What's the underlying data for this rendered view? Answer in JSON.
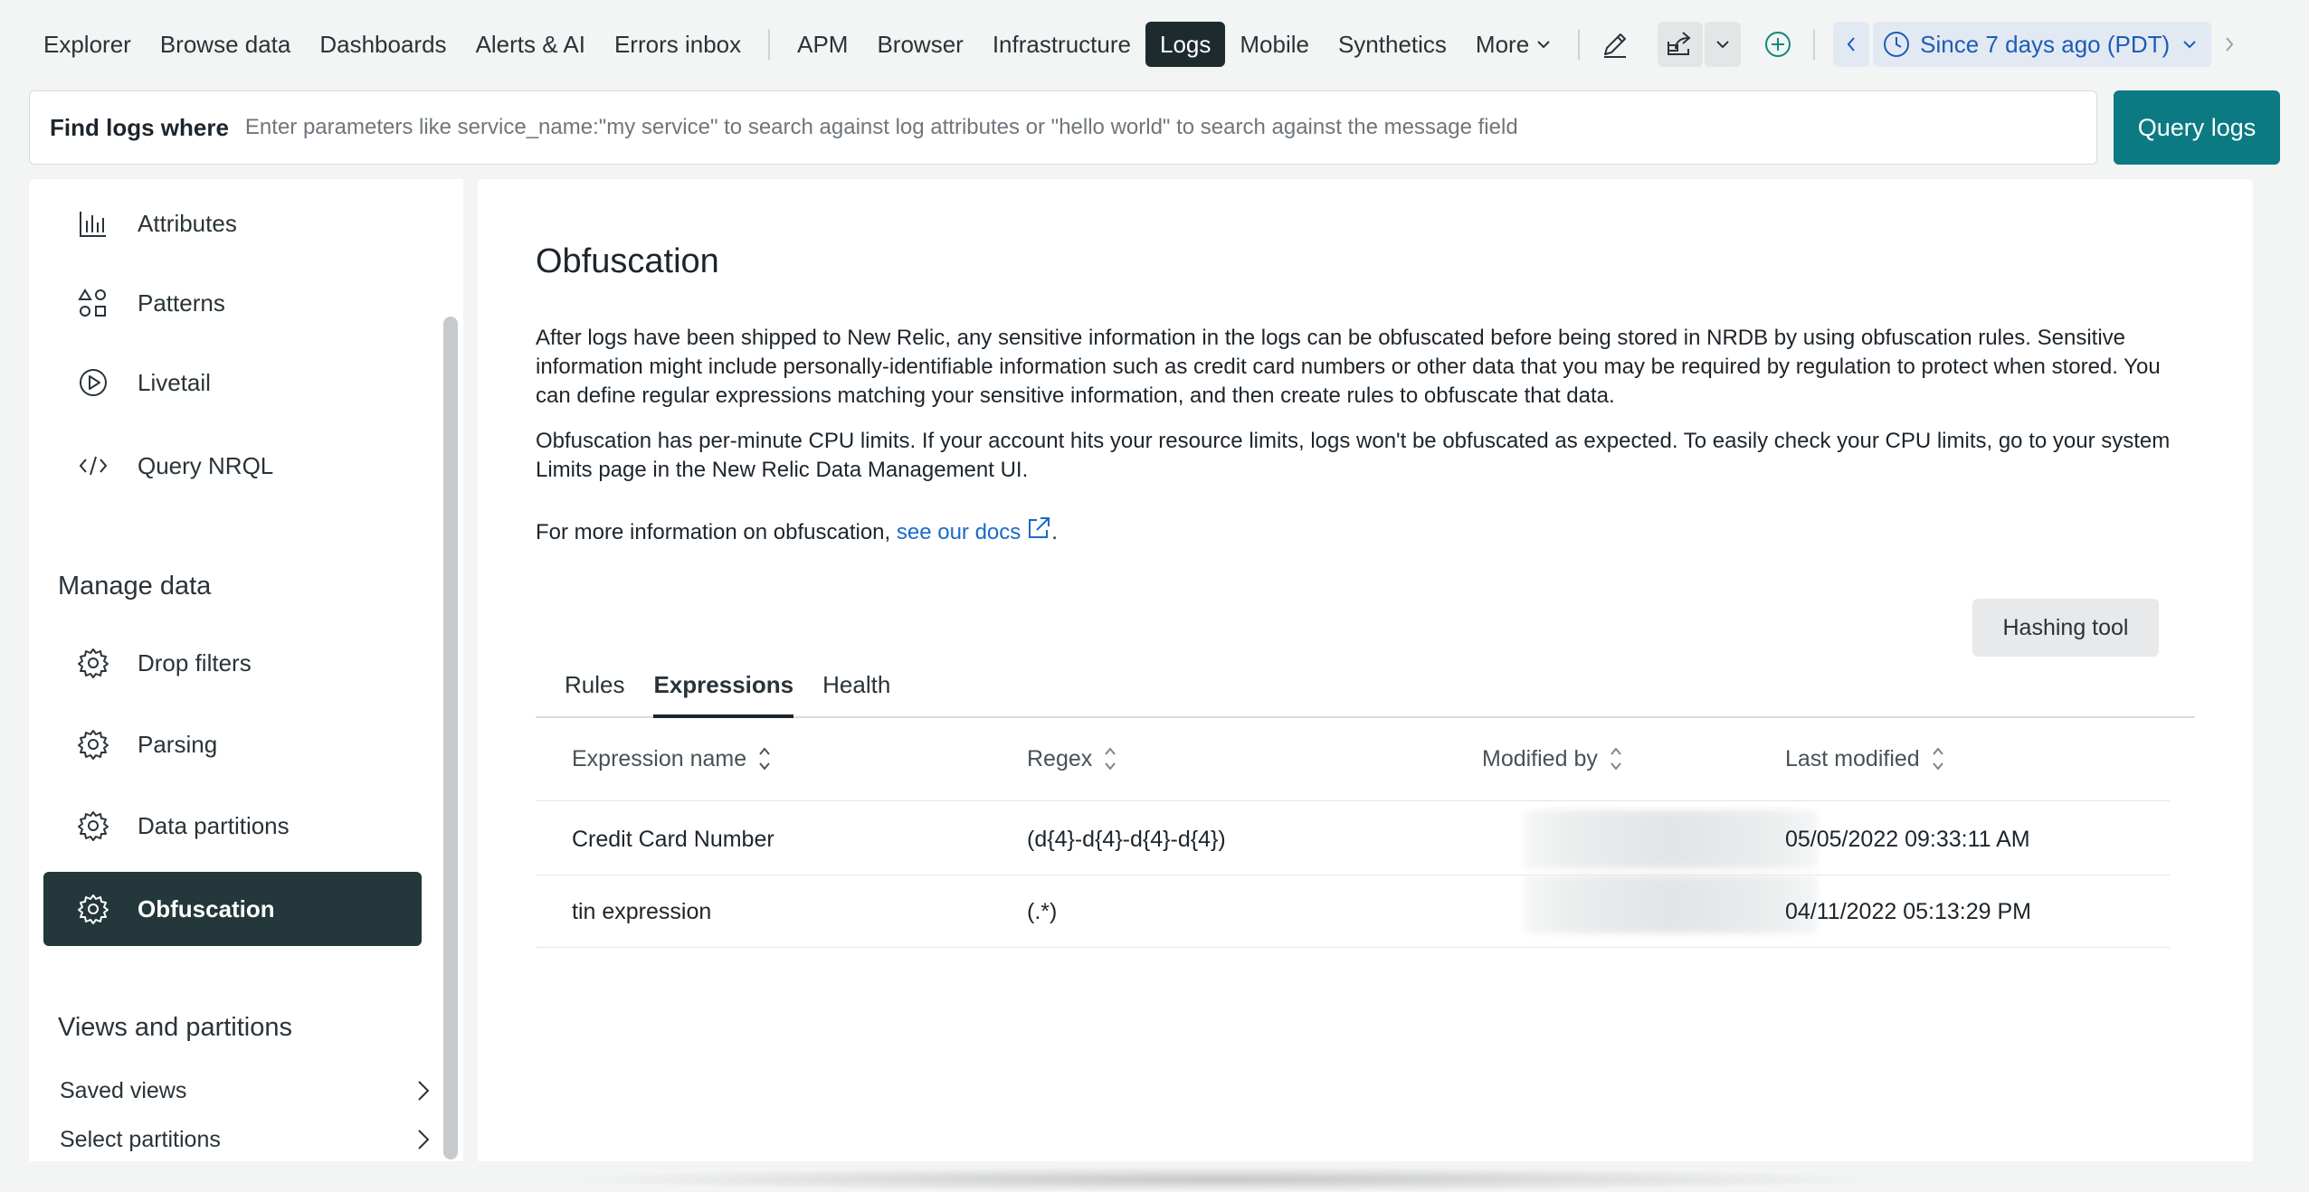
{
  "nav": {
    "items": [
      {
        "label": "Explorer"
      },
      {
        "label": "Browse data"
      },
      {
        "label": "Dashboards"
      },
      {
        "label": "Alerts & AI"
      },
      {
        "label": "Errors inbox"
      }
    ],
    "items2": [
      {
        "label": "APM"
      },
      {
        "label": "Browser"
      },
      {
        "label": "Infrastructure"
      },
      {
        "label": "Logs",
        "active": true
      },
      {
        "label": "Mobile"
      },
      {
        "label": "Synthetics"
      },
      {
        "label": "More"
      }
    ],
    "time_label": "Since 7 days ago (PDT)",
    "icons": [
      "pencil-icon",
      "share-icon",
      "chevron-down-icon",
      "plus-circle-icon",
      "chevron-left-icon",
      "clock-icon",
      "chevron-right-icon"
    ],
    "accent": "#1c5db6"
  },
  "search": {
    "label": "Find logs where",
    "placeholder": "Enter parameters like service_name:\"my service\" to search against log attributes or \"hello world\" to search against the message field",
    "button": "Query logs",
    "button_color": "#0b7a82"
  },
  "sidebar": {
    "items": [
      {
        "label": "Attributes",
        "icon": "bar-chart-icon"
      },
      {
        "label": "Patterns",
        "icon": "patterns-icon"
      },
      {
        "label": "Livetail",
        "icon": "play-circle-icon"
      },
      {
        "label": "Query NRQL",
        "icon": "code-icon"
      }
    ],
    "manage_heading": "Manage data",
    "manage_items": [
      {
        "label": "Drop filters",
        "icon": "gear-icon"
      },
      {
        "label": "Parsing",
        "icon": "gear-icon"
      },
      {
        "label": "Data partitions",
        "icon": "gear-icon"
      },
      {
        "label": "Obfuscation",
        "icon": "gear-icon",
        "active": true
      }
    ],
    "views_heading": "Views and partitions",
    "links": [
      {
        "label": "Saved views"
      },
      {
        "label": "Select partitions"
      }
    ]
  },
  "main": {
    "title": "Obfuscation",
    "para1": "After logs have been shipped to New Relic, any sensitive information in the logs can be obfuscated before being stored in NRDB by using obfuscation rules. Sensitive information might include personally-identifiable information such as credit card numbers or other data that you may be required by regulation to protect when stored. You can define regular expressions matching your sensitive information, and then create rules to obfuscate that data.",
    "para2": "Obfuscation has per-minute CPU limits. If your account hits your resource limits, logs won't be obfuscated as expected. To easily check your CPU limits, go to your system Limits page in the New Relic Data Management UI.",
    "para3_prefix": "For more information on obfuscation, ",
    "para3_link": "see our docs",
    "para3_suffix": ".",
    "hashing_button": "Hashing tool",
    "tabs": [
      {
        "label": "Rules"
      },
      {
        "label": "Expressions",
        "active": true
      },
      {
        "label": "Health"
      }
    ],
    "table": {
      "columns": [
        "Expression name",
        "Regex",
        "Modified by",
        "Last modified"
      ],
      "rows": [
        {
          "name": "Credit Card Number",
          "regex": "(d{4}-d{4}-d{4}-d{4})",
          "modified": "05/05/2022 09:33:11 AM"
        },
        {
          "name": "tin expression",
          "regex": "(.*)",
          "modified": "04/11/2022 05:13:29 PM"
        }
      ]
    }
  }
}
